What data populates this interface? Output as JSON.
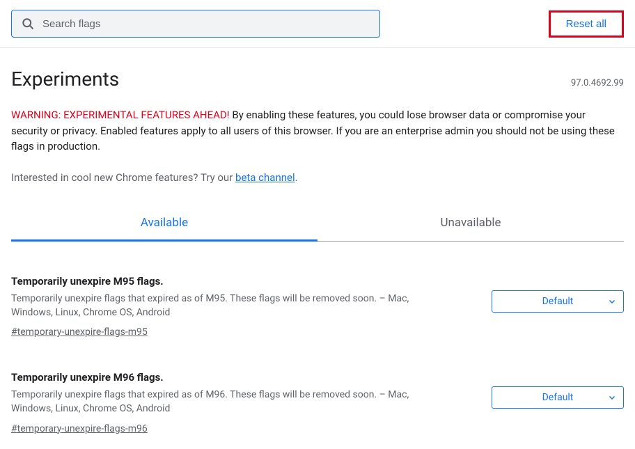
{
  "search": {
    "placeholder": "Search flags"
  },
  "reset_label": "Reset all",
  "title": "Experiments",
  "version": "97.0.4692.99",
  "warning": {
    "label": "WARNING: EXPERIMENTAL FEATURES AHEAD!",
    "body": " By enabling these features, you could lose browser data or compromise your security or privacy. Enabled features apply to all users of this browser. If you are an enterprise admin you should not be using these flags in production."
  },
  "interest": {
    "prefix": "Interested in cool new Chrome features? Try our ",
    "link": "beta channel",
    "suffix": "."
  },
  "tabs": {
    "available": "Available",
    "unavailable": "Unavailable"
  },
  "flags": [
    {
      "title": "Temporarily unexpire M95 flags.",
      "desc": "Temporarily unexpire flags that expired as of M95. These flags will be removed soon. – Mac, Windows, Linux, Chrome OS, Android",
      "anchor": "#temporary-unexpire-flags-m95",
      "select": "Default"
    },
    {
      "title": "Temporarily unexpire M96 flags.",
      "desc": "Temporarily unexpire flags that expired as of M96. These flags will be removed soon. – Mac, Windows, Linux, Chrome OS, Android",
      "anchor": "#temporary-unexpire-flags-m96",
      "select": "Default"
    }
  ]
}
